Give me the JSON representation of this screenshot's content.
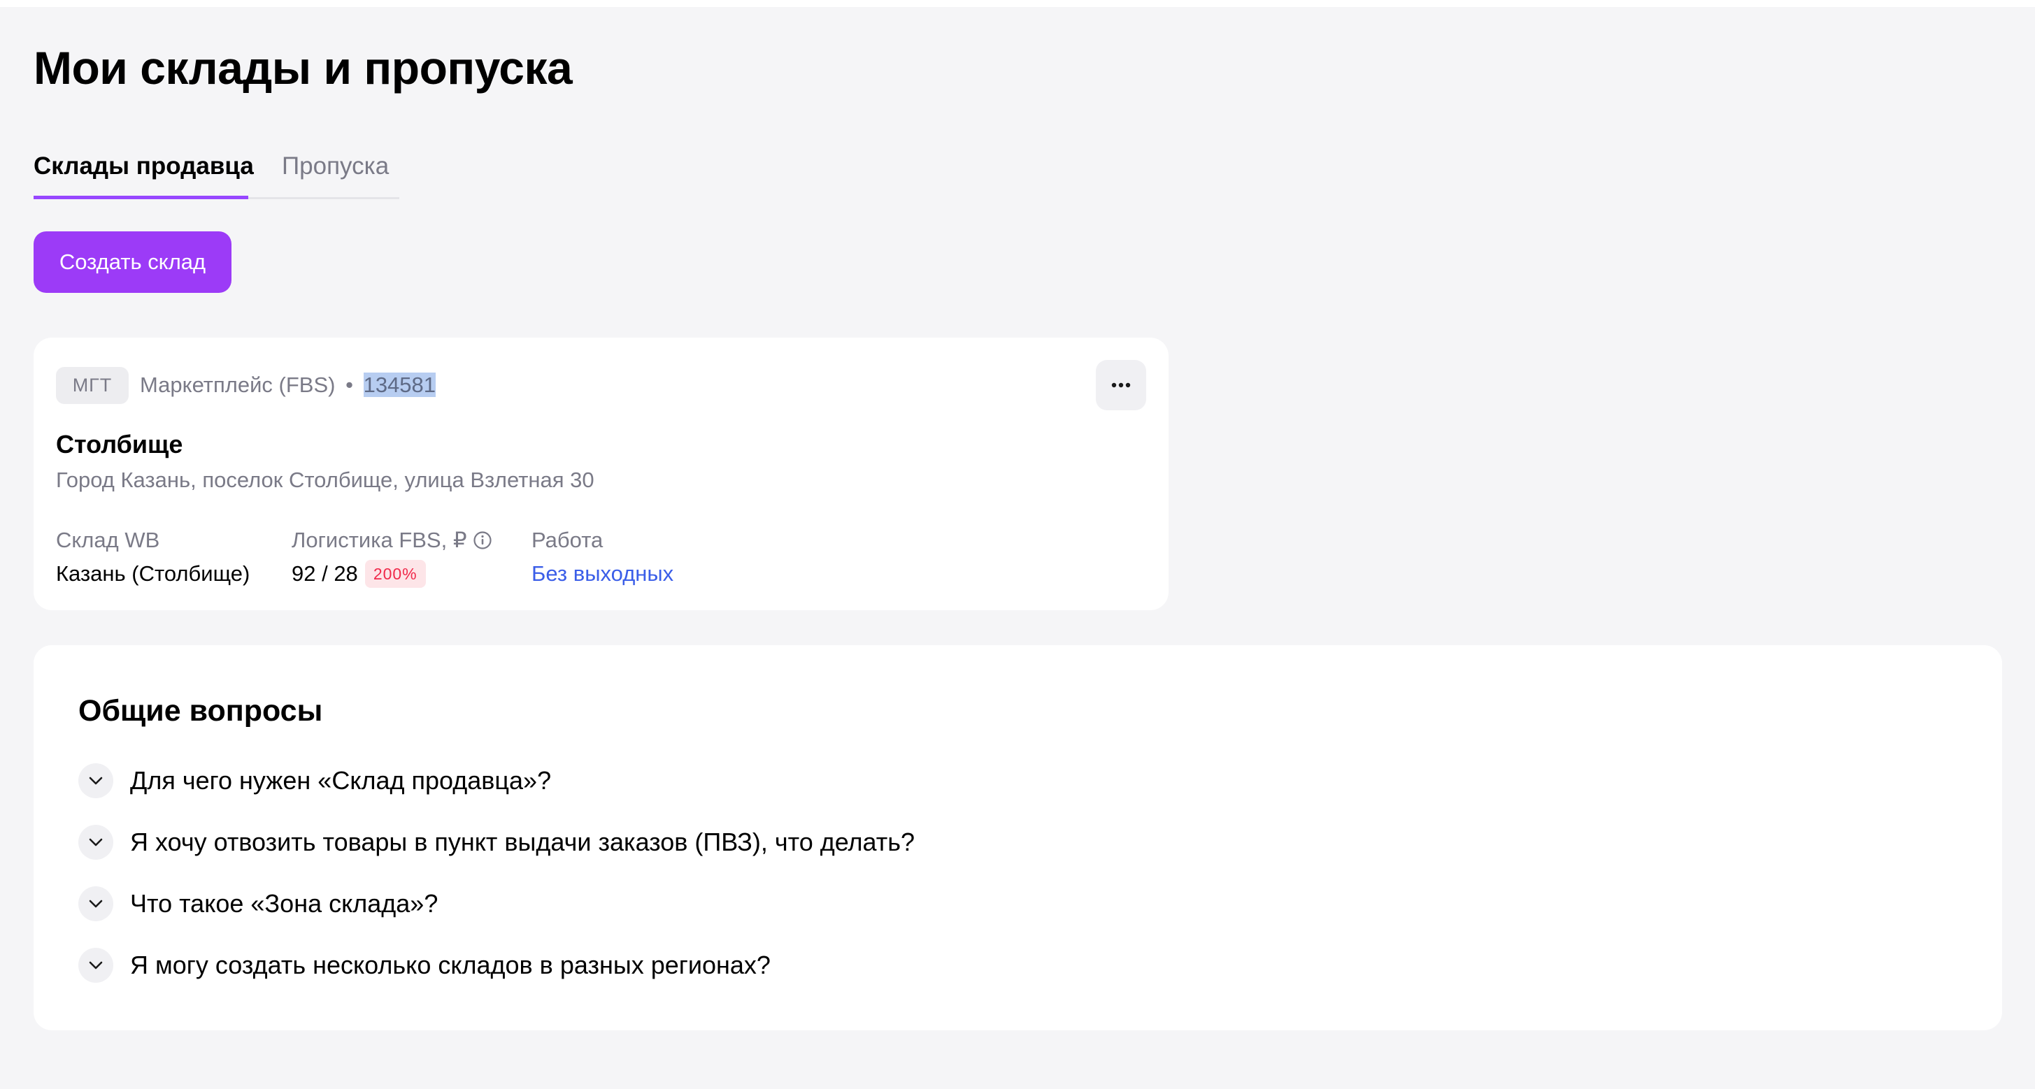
{
  "page": {
    "title": "Мои склады и пропуска"
  },
  "tabs": [
    {
      "label": "Склады продавца",
      "active": true
    },
    {
      "label": "Пропуска",
      "active": false
    }
  ],
  "actions": {
    "create_label": "Создать склад"
  },
  "warehouse": {
    "tag": "МГТ",
    "type": "Маркетплейс (FBS)",
    "separator": "•",
    "id": "134581",
    "name": "Столбище",
    "address": "Город Казань, поселок Столбище, улица Взлетная 30",
    "columns": {
      "wb_label": "Склад WB",
      "wb_value": "Казань (Столбище)",
      "logistics_label": "Логистика FBS, ₽",
      "logistics_value": "92 / 28",
      "logistics_badge": "200%",
      "work_label": "Работа",
      "work_value": "Без выходных"
    }
  },
  "faq": {
    "title": "Общие вопросы",
    "items": [
      {
        "question": "Для чего нужен «Склад продавца»?"
      },
      {
        "question": "Я хочу отвозить товары в пункт выдачи заказов (ПВЗ), что делать?"
      },
      {
        "question": "Что такое «Зона склада»?"
      },
      {
        "question": "Я могу создать несколько складов в разных регионах?"
      }
    ]
  },
  "colors": {
    "accent": "#9c3bf7",
    "tab_underline": "#9747ff",
    "link": "#3b5ee8",
    "badge_text": "#f0294a",
    "badge_bg": "#fde5e8",
    "secondary_text": "#7a7a87",
    "background": "#f5f5f7"
  },
  "icons": {
    "more": "more-horizontal-icon",
    "info": "info-icon",
    "chevron": "chevron-down-icon"
  }
}
